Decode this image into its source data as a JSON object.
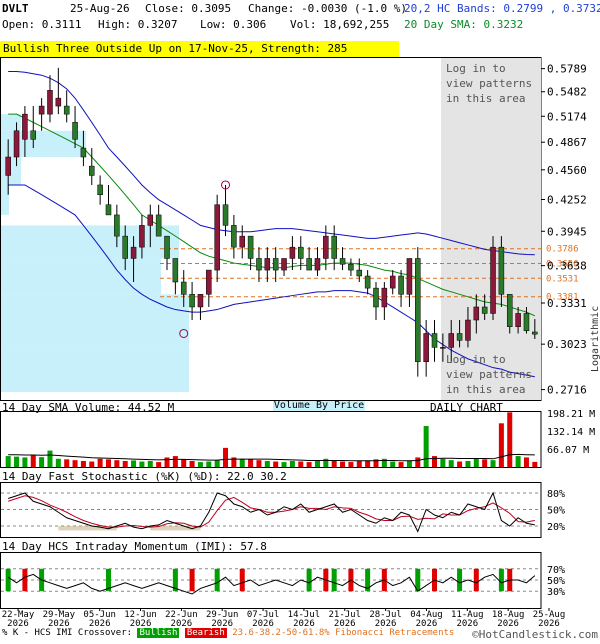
{
  "header": {
    "symbol": "DVLT",
    "date": "25-Aug-26",
    "close": "Close: 0.3095",
    "change": "Change: -0.0030 (-1.0 %)",
    "open": "Open: 0.3111",
    "high": "High: 0.3207",
    "low": "Low: 0.306",
    "vol": "Vol: 18,692,255",
    "bands": "20,2 HC Bands: 0.2799 , 0.3732",
    "sma": "20 Day SMA: 0.3232"
  },
  "banner": "Bullish Three Outside Up on 17-Nov-25, Strength: 285",
  "login_text": "Log in to\nview patterns\nin this area",
  "panels": {
    "volume_title": "14 Day SMA Volume: 44.52 M",
    "vbp_label": "Volume By Price",
    "daily_label": "DAILY CHART",
    "stoch_title": "14 Day Fast Stochastic (%K) (%D): 22.0   30.2",
    "imi_title": "14 Day HCS Intraday Momentum (IMI): 57.8",
    "logarithmic": "Logarithmic"
  },
  "legend": {
    "prefix": "% K - HCS IMI Crossover:",
    "bullish": "Bullish",
    "bearish": "Bearish",
    "fib": "23.6-38.2-50-61.8% Fibonacci Retracements"
  },
  "watermark": "©HotCandlestick.com",
  "colors": {
    "up": "#8b1a3a",
    "down": "#2a7a2a",
    "band": "#1010c0",
    "sma": "#0a8a0a",
    "fib": "#e07020",
    "vbp": "#c8f0fb",
    "shade": "#e4e4e4",
    "vol_up": "#00a000",
    "vol_down": "#e00000"
  },
  "chart_data": {
    "type": "candlestick",
    "scale": "log",
    "price_ticks": [
      "0.5789",
      "0.5482",
      "0.5174",
      "0.4867",
      "0.4560",
      "0.4252",
      "0.3945",
      "0.3638",
      "0.3331",
      "0.3023",
      "0.2716"
    ],
    "price_tick_values": [
      0.5789,
      0.5482,
      0.5174,
      0.4867,
      0.456,
      0.4252,
      0.3945,
      0.3638,
      0.3331,
      0.3023,
      0.2716
    ],
    "fib_levels": [
      0.3786,
      0.3656,
      0.3531,
      0.3381
    ],
    "fib_labels": [
      "0.3786",
      "0.3656",
      "0.3531",
      "0.3381"
    ],
    "x_labels": [
      {
        "d": "22-May",
        "y": "2026"
      },
      {
        "d": "29-May",
        "y": "2026"
      },
      {
        "d": "05-Jun",
        "y": "2026"
      },
      {
        "d": "12-Jun",
        "y": "2026"
      },
      {
        "d": "22-Jun",
        "y": "2026"
      },
      {
        "d": "29-Jun",
        "y": "2026"
      },
      {
        "d": "07-Jul",
        "y": "2026"
      },
      {
        "d": "14-Jul",
        "y": "2026"
      },
      {
        "d": "21-Jul",
        "y": "2026"
      },
      {
        "d": "28-Jul",
        "y": "2026"
      },
      {
        "d": "04-Aug",
        "y": "2026"
      },
      {
        "d": "11-Aug",
        "y": "2026"
      },
      {
        "d": "18-Aug",
        "y": "2026"
      },
      {
        "d": "25-Aug",
        "y": "2026"
      }
    ],
    "volume_ticks": [
      "198.21 M",
      "132.14 M",
      "66.07 M"
    ],
    "volume_tick_values": [
      198.21,
      132.14,
      66.07
    ],
    "stoch_ticks": [
      "80%",
      "50%",
      "20%"
    ],
    "stoch_tick_values": [
      80,
      50,
      20
    ],
    "imi_ticks": [
      "70%",
      "50%",
      "30%"
    ],
    "imi_tick_values": [
      70,
      50,
      30
    ],
    "candles": [
      [
        0.45,
        0.49,
        0.43,
        0.47
      ],
      [
        0.47,
        0.51,
        0.46,
        0.5
      ],
      [
        0.49,
        0.53,
        0.47,
        0.52
      ],
      [
        0.5,
        0.53,
        0.48,
        0.49
      ],
      [
        0.52,
        0.54,
        0.5,
        0.53
      ],
      [
        0.52,
        0.57,
        0.51,
        0.55
      ],
      [
        0.53,
        0.58,
        0.52,
        0.54
      ],
      [
        0.53,
        0.55,
        0.51,
        0.52
      ],
      [
        0.51,
        0.53,
        0.48,
        0.49
      ],
      [
        0.48,
        0.5,
        0.46,
        0.47
      ],
      [
        0.46,
        0.48,
        0.44,
        0.45
      ],
      [
        0.44,
        0.45,
        0.42,
        0.43
      ],
      [
        0.42,
        0.44,
        0.41,
        0.41
      ],
      [
        0.41,
        0.42,
        0.38,
        0.39
      ],
      [
        0.39,
        0.4,
        0.36,
        0.37
      ],
      [
        0.37,
        0.39,
        0.35,
        0.38
      ],
      [
        0.38,
        0.41,
        0.37,
        0.4
      ],
      [
        0.4,
        0.42,
        0.38,
        0.41
      ],
      [
        0.41,
        0.42,
        0.39,
        0.39
      ],
      [
        0.39,
        0.39,
        0.36,
        0.37
      ],
      [
        0.37,
        0.37,
        0.34,
        0.35
      ],
      [
        0.35,
        0.36,
        0.33,
        0.34
      ],
      [
        0.34,
        0.35,
        0.32,
        0.33
      ],
      [
        0.33,
        0.34,
        0.32,
        0.34
      ],
      [
        0.34,
        0.36,
        0.33,
        0.36
      ],
      [
        0.36,
        0.43,
        0.35,
        0.42
      ],
      [
        0.42,
        0.44,
        0.39,
        0.4
      ],
      [
        0.4,
        0.41,
        0.37,
        0.38
      ],
      [
        0.38,
        0.4,
        0.37,
        0.39
      ],
      [
        0.39,
        0.39,
        0.36,
        0.37
      ],
      [
        0.37,
        0.38,
        0.35,
        0.36
      ],
      [
        0.36,
        0.38,
        0.35,
        0.37
      ],
      [
        0.37,
        0.38,
        0.35,
        0.36
      ],
      [
        0.36,
        0.37,
        0.355,
        0.37
      ],
      [
        0.37,
        0.39,
        0.36,
        0.38
      ],
      [
        0.38,
        0.39,
        0.36,
        0.37
      ],
      [
        0.37,
        0.38,
        0.36,
        0.36
      ],
      [
        0.36,
        0.38,
        0.355,
        0.37
      ],
      [
        0.37,
        0.4,
        0.36,
        0.39
      ],
      [
        0.39,
        0.4,
        0.36,
        0.37
      ],
      [
        0.37,
        0.38,
        0.36,
        0.365
      ],
      [
        0.365,
        0.37,
        0.355,
        0.36
      ],
      [
        0.36,
        0.37,
        0.35,
        0.355
      ],
      [
        0.355,
        0.36,
        0.34,
        0.345
      ],
      [
        0.345,
        0.35,
        0.32,
        0.33
      ],
      [
        0.33,
        0.35,
        0.32,
        0.345
      ],
      [
        0.345,
        0.36,
        0.34,
        0.355
      ],
      [
        0.355,
        0.36,
        0.33,
        0.34
      ],
      [
        0.34,
        0.37,
        0.33,
        0.37
      ],
      [
        0.37,
        0.38,
        0.28,
        0.29
      ],
      [
        0.29,
        0.32,
        0.28,
        0.31
      ],
      [
        0.31,
        0.32,
        0.29,
        0.3
      ],
      [
        0.3,
        0.31,
        0.29,
        0.3
      ],
      [
        0.3,
        0.32,
        0.29,
        0.31
      ],
      [
        0.31,
        0.32,
        0.3,
        0.305
      ],
      [
        0.305,
        0.33,
        0.3,
        0.32
      ],
      [
        0.32,
        0.34,
        0.31,
        0.33
      ],
      [
        0.33,
        0.34,
        0.32,
        0.325
      ],
      [
        0.325,
        0.39,
        0.32,
        0.38
      ],
      [
        0.38,
        0.39,
        0.33,
        0.34
      ],
      [
        0.34,
        0.34,
        0.31,
        0.315
      ],
      [
        0.315,
        0.33,
        0.31,
        0.325
      ],
      [
        0.325,
        0.33,
        0.31,
        0.312
      ],
      [
        0.3111,
        0.3207,
        0.306,
        0.3095
      ]
    ],
    "sma20": [
      0.52,
      0.52,
      0.515,
      0.51,
      0.505,
      0.5,
      0.495,
      0.49,
      0.485,
      0.48,
      0.47,
      0.46,
      0.45,
      0.44,
      0.43,
      0.42,
      0.41,
      0.405,
      0.4,
      0.395,
      0.39,
      0.385,
      0.38,
      0.375,
      0.372,
      0.37,
      0.368,
      0.366,
      0.365,
      0.364,
      0.363,
      0.362,
      0.362,
      0.362,
      0.363,
      0.364,
      0.364,
      0.364,
      0.365,
      0.366,
      0.366,
      0.366,
      0.365,
      0.364,
      0.362,
      0.36,
      0.359,
      0.357,
      0.356,
      0.353,
      0.35,
      0.347,
      0.344,
      0.342,
      0.34,
      0.338,
      0.336,
      0.334,
      0.333,
      0.332,
      0.33,
      0.328,
      0.326,
      0.3232
    ],
    "upper_band": [
      0.575,
      0.575,
      0.574,
      0.572,
      0.57,
      0.566,
      0.56,
      0.552,
      0.54,
      0.525,
      0.51,
      0.495,
      0.48,
      0.47,
      0.46,
      0.45,
      0.44,
      0.432,
      0.425,
      0.42,
      0.415,
      0.41,
      0.405,
      0.4,
      0.398,
      0.396,
      0.395,
      0.394,
      0.394,
      0.394,
      0.395,
      0.396,
      0.397,
      0.397,
      0.397,
      0.396,
      0.395,
      0.394,
      0.393,
      0.392,
      0.391,
      0.39,
      0.389,
      0.388,
      0.388,
      0.389,
      0.39,
      0.391,
      0.392,
      0.393,
      0.392,
      0.39,
      0.388,
      0.386,
      0.384,
      0.382,
      0.38,
      0.378,
      0.377,
      0.376,
      0.375,
      0.374,
      0.3735,
      0.3732
    ],
    "lower_band": [
      0.44,
      0.44,
      0.44,
      0.435,
      0.43,
      0.425,
      0.42,
      0.415,
      0.41,
      0.4,
      0.39,
      0.38,
      0.37,
      0.36,
      0.352,
      0.345,
      0.34,
      0.336,
      0.333,
      0.33,
      0.328,
      0.327,
      0.326,
      0.326,
      0.327,
      0.328,
      0.33,
      0.332,
      0.333,
      0.334,
      0.335,
      0.336,
      0.337,
      0.338,
      0.339,
      0.34,
      0.341,
      0.342,
      0.342,
      0.343,
      0.343,
      0.343,
      0.342,
      0.341,
      0.338,
      0.334,
      0.33,
      0.326,
      0.322,
      0.318,
      0.312,
      0.306,
      0.302,
      0.298,
      0.295,
      0.292,
      0.29,
      0.288,
      0.286,
      0.285,
      0.283,
      0.282,
      0.281,
      0.2799
    ],
    "volume": [
      40,
      38,
      35,
      42,
      36,
      60,
      30,
      28,
      25,
      22,
      20,
      30,
      28,
      25,
      22,
      24,
      20,
      22,
      18,
      35,
      40,
      28,
      22,
      18,
      20,
      25,
      70,
      35,
      30,
      28,
      25,
      22,
      20,
      18,
      22,
      20,
      18,
      22,
      30,
      25,
      20,
      18,
      22,
      24,
      28,
      30,
      20,
      18,
      22,
      35,
      150,
      40,
      30,
      25,
      20,
      22,
      30,
      28,
      25,
      160,
      200,
      40,
      35,
      18.7
    ],
    "vol_sma": [
      45,
      45,
      44,
      44,
      43,
      44,
      42,
      40,
      38,
      36,
      34,
      33,
      32,
      31,
      30,
      29,
      28,
      27,
      26,
      27,
      28,
      28,
      27,
      26,
      25,
      25,
      28,
      29,
      29,
      29,
      29,
      29,
      28,
      27,
      26,
      25,
      24,
      24,
      24,
      24,
      24,
      23,
      23,
      23,
      23,
      24,
      24,
      23,
      23,
      24,
      30,
      31,
      32,
      32,
      31,
      31,
      31,
      31,
      30,
      37,
      45,
      46,
      45,
      44.5
    ],
    "stoch_k": [
      70,
      75,
      80,
      65,
      60,
      55,
      45,
      35,
      30,
      25,
      20,
      18,
      15,
      20,
      25,
      18,
      15,
      20,
      22,
      30,
      25,
      20,
      15,
      20,
      45,
      80,
      75,
      60,
      55,
      45,
      50,
      40,
      45,
      55,
      50,
      60,
      45,
      50,
      55,
      60,
      45,
      50,
      40,
      30,
      25,
      35,
      30,
      45,
      40,
      10,
      50,
      40,
      35,
      45,
      40,
      60,
      55,
      50,
      80,
      30,
      20,
      35,
      25,
      22
    ],
    "stoch_d": [
      65,
      70,
      75,
      72,
      66,
      58,
      52,
      45,
      37,
      30,
      25,
      21,
      18,
      18,
      20,
      21,
      19,
      18,
      19,
      24,
      26,
      25,
      20,
      18,
      27,
      48,
      67,
      72,
      63,
      53,
      50,
      45,
      45,
      47,
      50,
      55,
      52,
      52,
      50,
      55,
      53,
      52,
      45,
      40,
      33,
      30,
      30,
      37,
      38,
      32,
      34,
      33,
      42,
      40,
      40,
      48,
      52,
      55,
      62,
      53,
      43,
      28,
      27,
      30.2
    ],
    "imi": [
      55,
      45,
      55,
      60,
      50,
      45,
      40,
      35,
      40,
      45,
      35,
      30,
      35,
      40,
      45,
      40,
      35,
      40,
      45,
      40,
      35,
      30,
      25,
      35,
      40,
      45,
      55,
      40,
      45,
      50,
      40,
      45,
      50,
      45,
      40,
      50,
      45,
      55,
      50,
      45,
      40,
      50,
      40,
      35,
      45,
      50,
      40,
      45,
      55,
      30,
      40,
      50,
      45,
      55,
      45,
      50,
      45,
      55,
      60,
      45,
      50,
      50,
      45,
      57.8
    ],
    "imi_bars": [
      [
        0,
        "bull"
      ],
      [
        2,
        "bear"
      ],
      [
        4,
        "bull"
      ],
      [
        12,
        "bull"
      ],
      [
        20,
        "bull"
      ],
      [
        22,
        "bear"
      ],
      [
        25,
        "bull"
      ],
      [
        28,
        "bear"
      ],
      [
        36,
        "bull"
      ],
      [
        38,
        "bear"
      ],
      [
        39,
        "bull"
      ],
      [
        41,
        "bear"
      ],
      [
        43,
        "bull"
      ],
      [
        45,
        "bear"
      ],
      [
        49,
        "bull"
      ],
      [
        51,
        "bear"
      ],
      [
        54,
        "bull"
      ],
      [
        56,
        "bear"
      ],
      [
        59,
        "bull"
      ],
      [
        60,
        "bear"
      ]
    ]
  }
}
